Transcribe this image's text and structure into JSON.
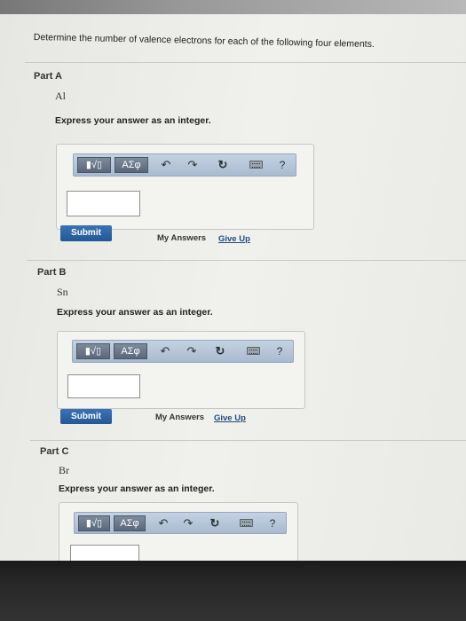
{
  "question": "Determine the number of valence electrons for each of the following four elements.",
  "toolbar": {
    "templates_label": "▮√▯",
    "symbols_label": "ΑΣφ",
    "help_label": "?"
  },
  "parts": [
    {
      "label": "Part A",
      "element": "Al",
      "instruction": "Express your answer as an integer.",
      "submit_label": "Submit",
      "my_answers_label": "My Answers",
      "give_up_label": "Give Up",
      "answer_value": ""
    },
    {
      "label": "Part B",
      "element": "Sn",
      "instruction": "Express your answer as an integer.",
      "submit_label": "Submit",
      "my_answers_label": "My Answers",
      "give_up_label": "Give Up",
      "answer_value": ""
    },
    {
      "label": "Part C",
      "element": "Br",
      "instruction": "Express your answer as an integer.",
      "answer_value": ""
    }
  ]
}
